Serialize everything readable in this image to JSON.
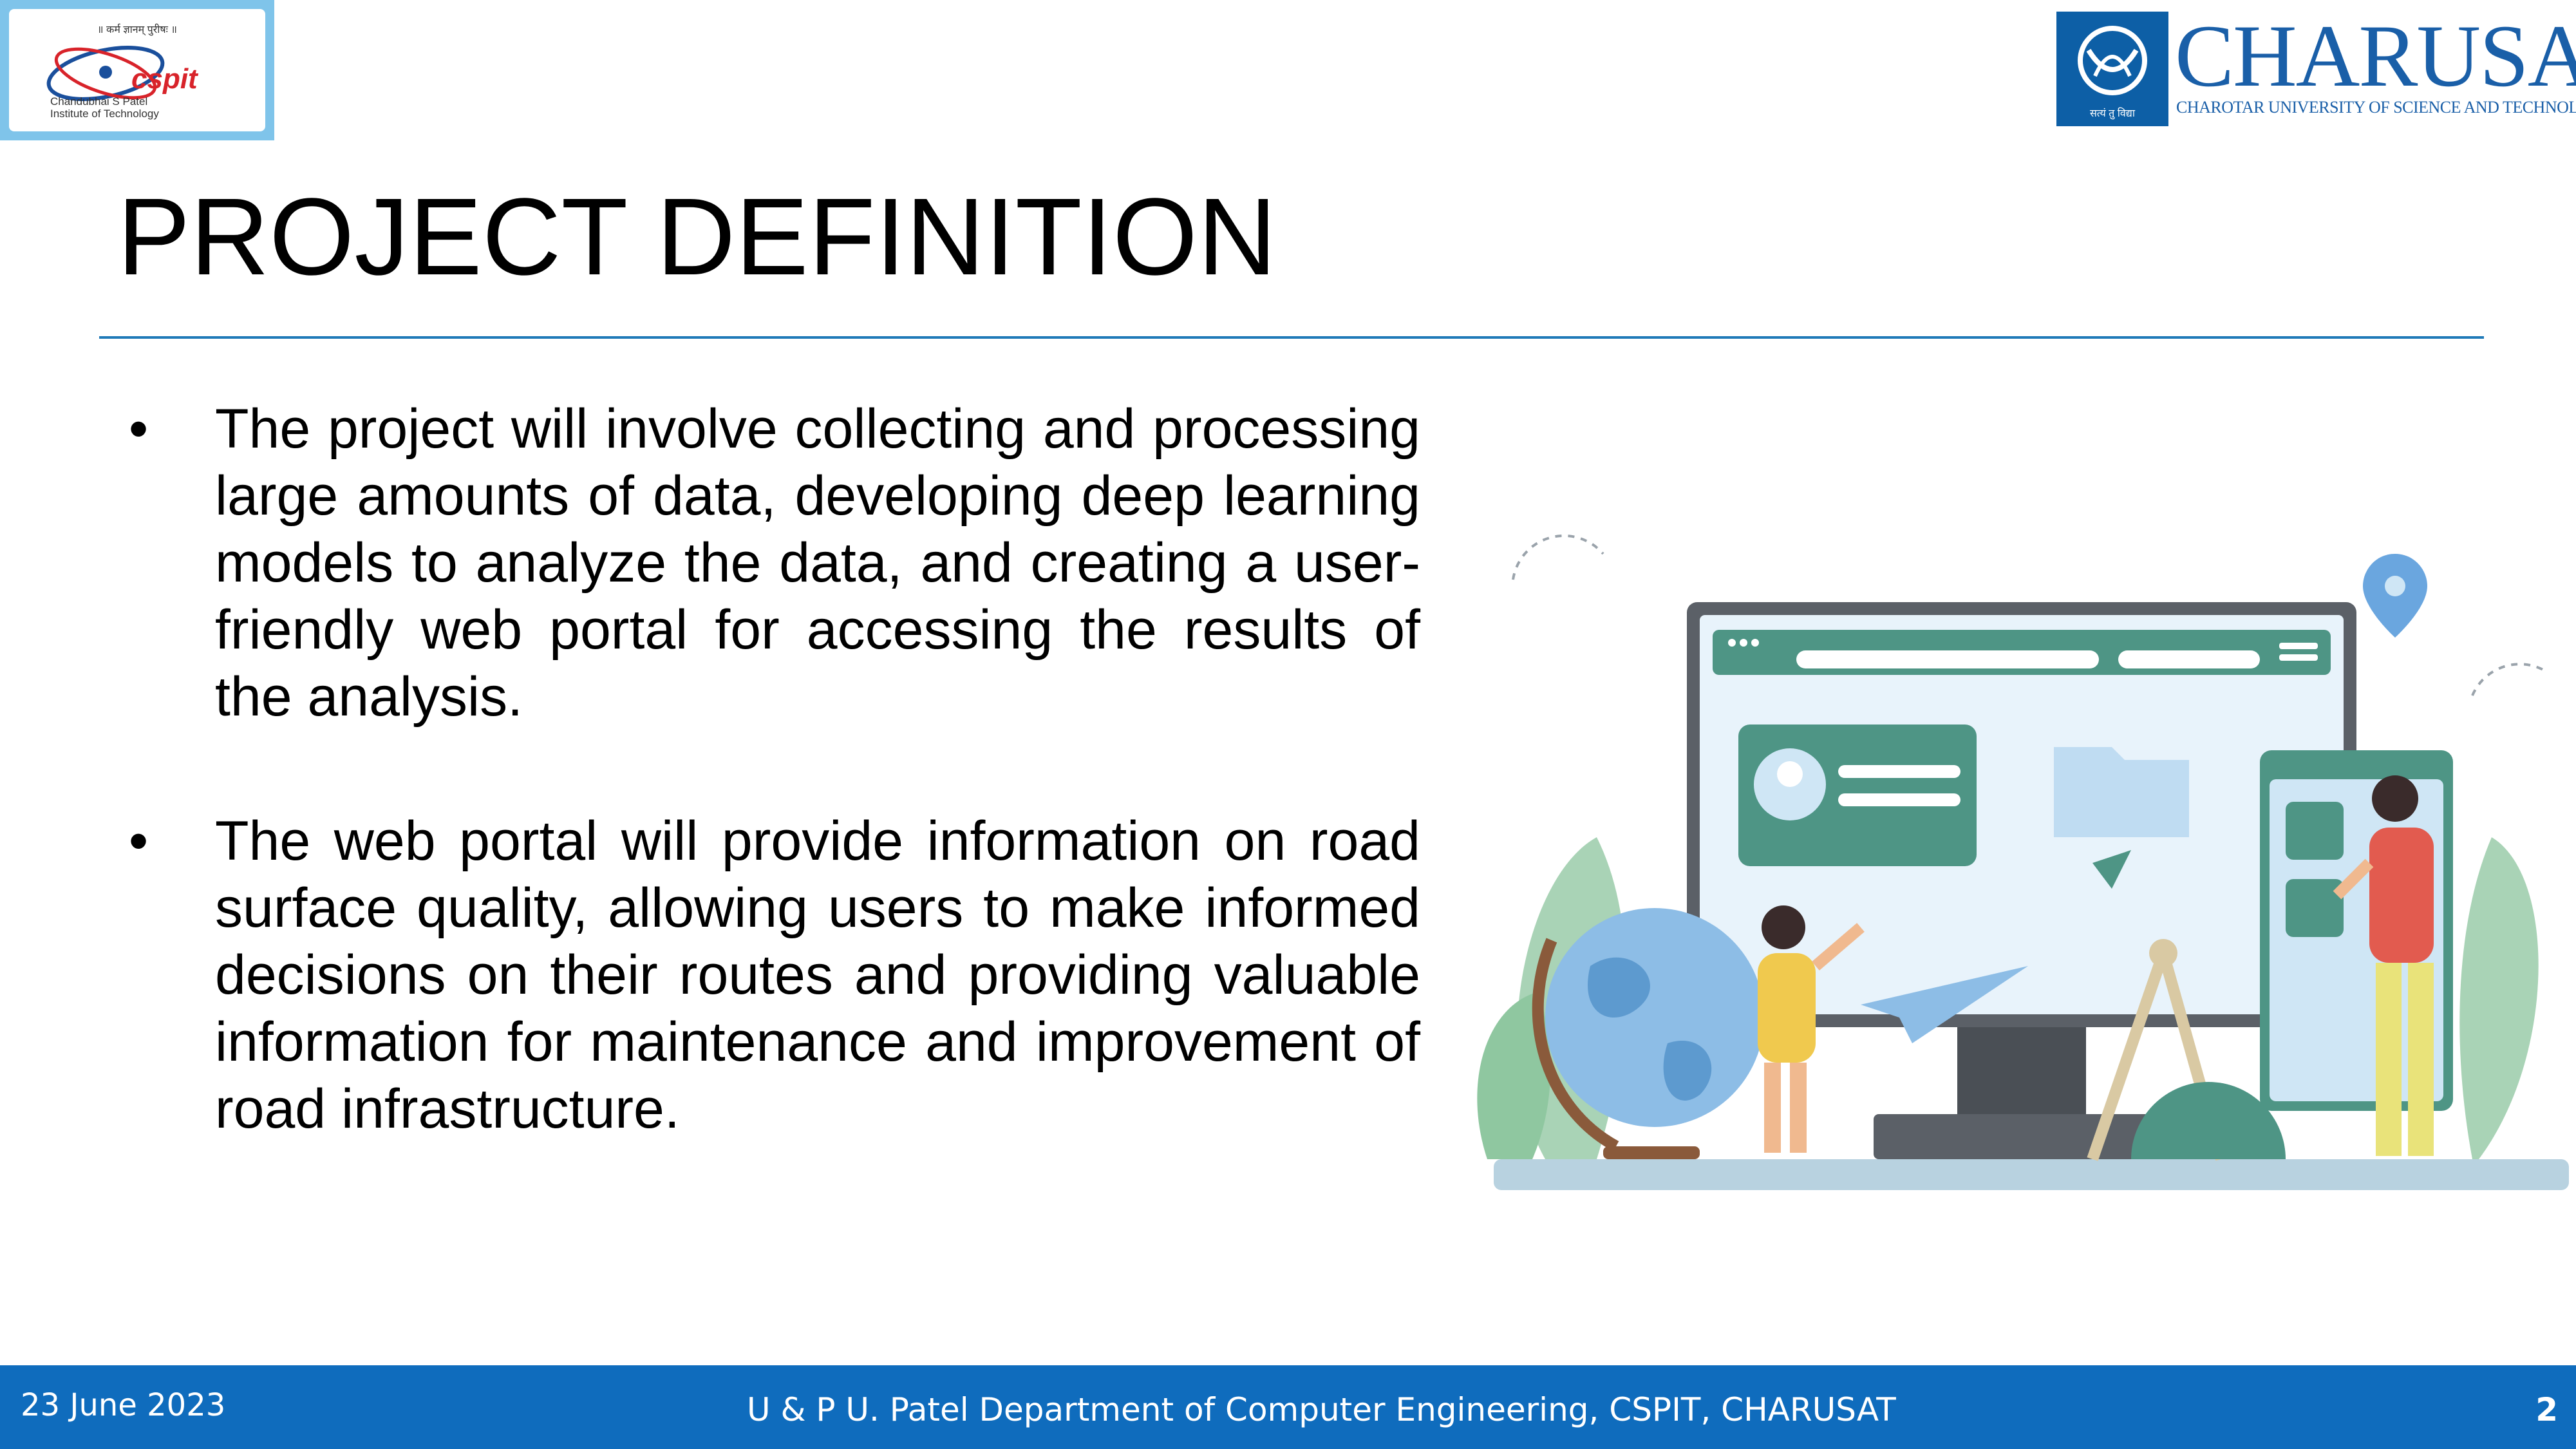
{
  "header": {
    "left_logo": {
      "tagline": "॥ कर्म ज्ञानम् पुरीषः ॥",
      "name": "cspit",
      "institute_line1": "Chandubhai S Patel",
      "institute_line2": "Institute of Technology"
    },
    "right_logo": {
      "name": "CHARUSAT",
      "full_name": "CHAROTAR UNIVERSITY OF SCIENCE AND TECHNOLOGY",
      "motto": "सत्यं तु विद्या"
    }
  },
  "slide": {
    "title": "PROJECT DEFINITION",
    "bullets": [
      "The project will involve collecting and processing large amounts of data, developing deep learning models to analyze the data, and creating a user-friendly web portal for accessing the results of the analysis.",
      "The web portal will provide information on road surface quality, allowing users to make informed decisions on their routes and providing valuable information for maintenance and improvement of road infrastructure."
    ],
    "bullet_symbol": "•"
  },
  "footer": {
    "date": "23 June 2023",
    "department": "U & P U. Patel Department of Computer Engineering, CSPIT, CHARUSAT",
    "page_number": "2"
  },
  "colors": {
    "footer_bar": "#0f6cbd",
    "rule": "#1f7ab8",
    "charusat_blue": "#1a5fa8",
    "cspit_red": "#d8232a"
  }
}
